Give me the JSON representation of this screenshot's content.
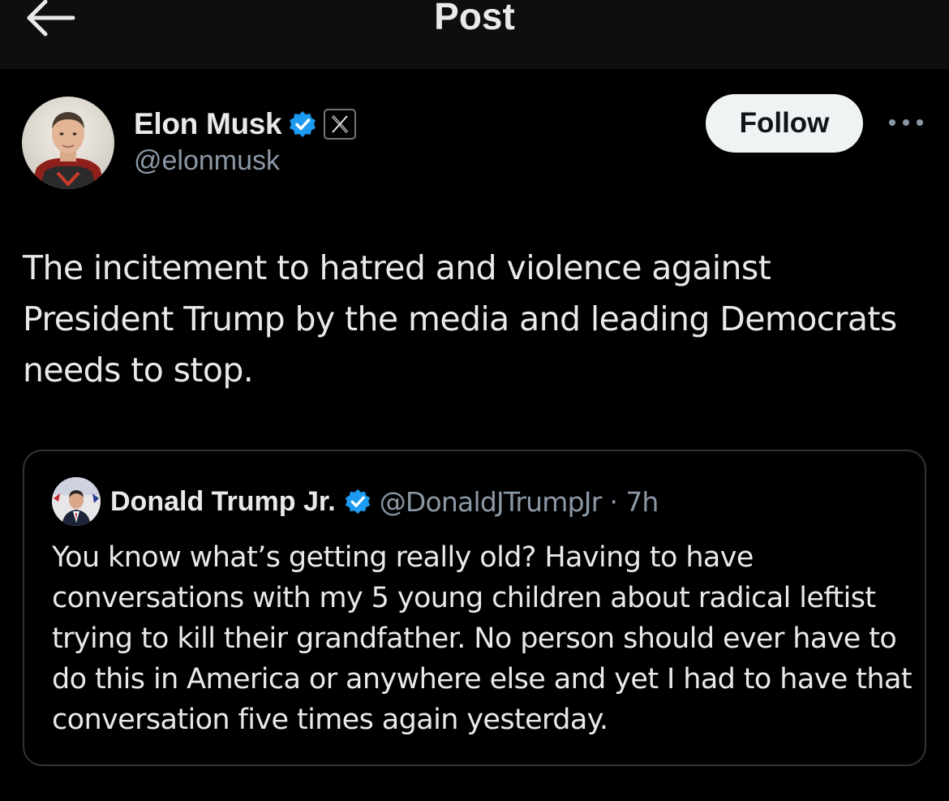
{
  "header": {
    "title": "Post",
    "back_icon": "arrow-left-icon"
  },
  "post": {
    "author": {
      "name": "Elon Musk",
      "handle": "@elonmusk",
      "verified_icon": "verified-badge-icon",
      "affiliation_icon": "x-logo-icon"
    },
    "follow_label": "Follow",
    "more_icon": "more-horizontal-icon",
    "text": "The incitement to hatred and violence against President Trump by the media and leading Democrats needs to stop.",
    "quote": {
      "author_name": "Donald Trump Jr.",
      "handle": "@DonaldJTrumpJr",
      "separator": "·",
      "time": "7h",
      "verified_icon": "verified-badge-icon",
      "text": "You know what’s getting really old? Having to have conversations with my 5 young children about radical leftist trying to kill their grandfather. No person should ever have to do this in America or anywhere else and yet I had to have that conversation five times again yesterday."
    }
  },
  "colors": {
    "background": "#000000",
    "header_background": "#0e0e0e",
    "text_primary": "#e7e9ea",
    "text_secondary": "#8b98a5",
    "verified_blue": "#1d9bf0",
    "border": "#2f3336",
    "follow_button_bg": "#eff3f4"
  }
}
